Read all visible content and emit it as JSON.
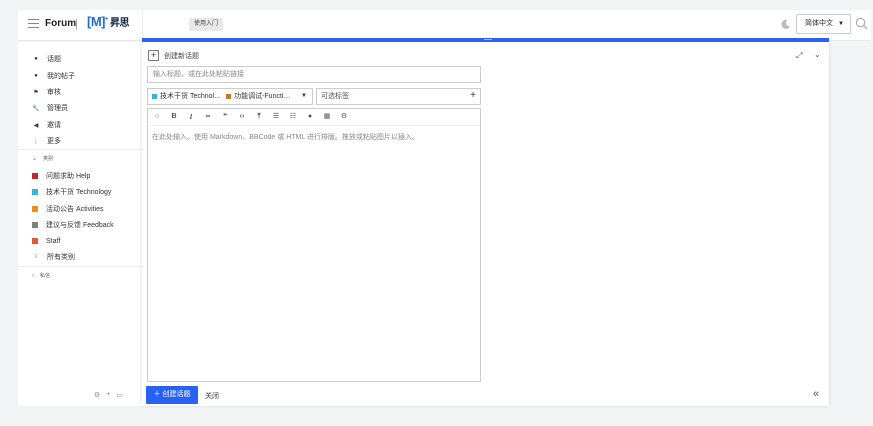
{
  "header": {
    "brand": "Forum",
    "logo_main": "[M]",
    "logo_sup": "+",
    "logo_cn": "昇思",
    "getting_started": "使用入门",
    "language": "简体中文"
  },
  "sidebar": {
    "nav": [
      {
        "label": "话题",
        "icon": "topics-icon"
      },
      {
        "label": "我的帖子",
        "icon": "user-icon"
      },
      {
        "label": "审核",
        "icon": "flag-icon"
      },
      {
        "label": "管理员",
        "icon": "wrench-icon"
      },
      {
        "label": "邀请",
        "icon": "paper-plane-icon"
      },
      {
        "label": "更多",
        "icon": "more-vertical-icon"
      }
    ],
    "categories_heading": "类别",
    "categories": [
      {
        "label": "问题求助 Help",
        "color": "#c0272d"
      },
      {
        "label": "技术干货 Technology",
        "color": "#3ab1d8"
      },
      {
        "label": "活动公告 Activities",
        "color": "#f08c1b"
      },
      {
        "label": "建议与反馈 Feedback",
        "color": "#808281"
      },
      {
        "label": "Staff",
        "color": "#e45735"
      },
      {
        "label": "所有类别",
        "color": "#919191"
      }
    ],
    "messages_heading": "私信"
  },
  "composer": {
    "title": "创建新话题",
    "title_placeholder": "输入标题，或在此处粘贴链接",
    "category_1": "技术干货 Technol…",
    "category_1_color": "#3ab1d8",
    "category_2": "功能调试-Functi…",
    "category_2_color": "#c07a2d",
    "tag_placeholder": "可选标签",
    "editor_placeholder": "在此处输入。使用 Markdown、BBCode 或 HTML 进行排版。拖放或粘贴图片以插入。",
    "submit_label": "创建话题",
    "close_label": "关闭",
    "accent": "#2862f5"
  }
}
